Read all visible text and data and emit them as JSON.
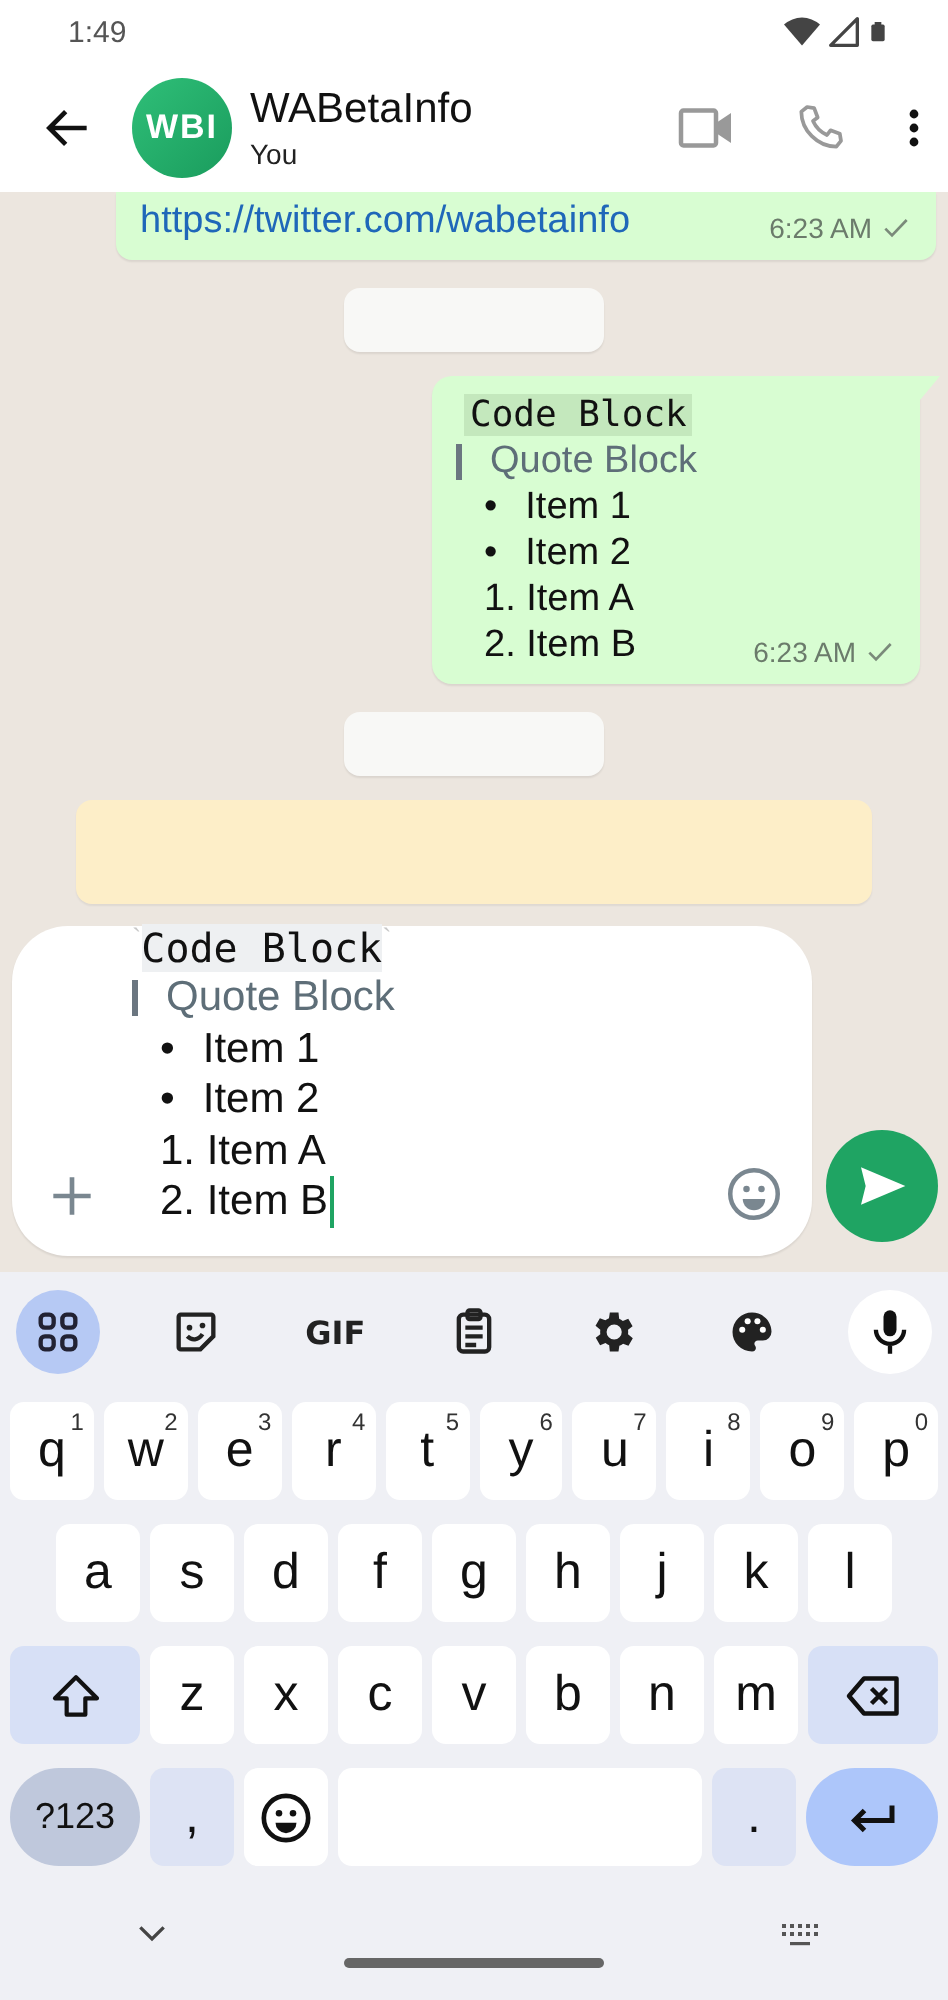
{
  "status_bar": {
    "time": "1:49"
  },
  "header": {
    "avatar_text": "WBI",
    "title": "WABetaInfo",
    "subtitle": "You"
  },
  "messages": [
    {
      "kind": "link",
      "text": "https://twitter.com/wabetainfo",
      "time": "6:23 AM",
      "read": false
    },
    {
      "kind": "blank_chip"
    },
    {
      "kind": "formatted",
      "time": "6:23 AM",
      "read": false,
      "lines": [
        {
          "kind": "code",
          "text": "Code Block"
        },
        {
          "kind": "quote",
          "text": "Quote Block"
        },
        {
          "kind": "bullet",
          "marker": "•",
          "text": "Item 1"
        },
        {
          "kind": "bullet",
          "marker": "•",
          "text": "Item 2"
        },
        {
          "kind": "numbered",
          "text": "1. Item A"
        },
        {
          "kind": "numbered",
          "text": "2. Item B"
        }
      ]
    },
    {
      "kind": "blank_chip"
    },
    {
      "kind": "banner"
    }
  ],
  "composer": {
    "fence": "`",
    "cursor_visible": true,
    "lines": [
      {
        "kind": "code",
        "text": "Code Block"
      },
      {
        "kind": "quote",
        "text": "Quote Block"
      },
      {
        "kind": "bullet",
        "marker": "•",
        "text": "Item 1"
      },
      {
        "kind": "bullet",
        "marker": "•",
        "text": "Item 2"
      },
      {
        "kind": "numbered",
        "text": "1. Item A"
      },
      {
        "kind": "numbered",
        "text": "2. Item B"
      }
    ]
  },
  "keyboard": {
    "toolbar": [
      {
        "kind": "apps",
        "selected": true
      },
      {
        "kind": "sticker",
        "selected": false
      },
      {
        "kind": "gif",
        "label": "GIF",
        "selected": false
      },
      {
        "kind": "clipboard",
        "selected": false
      },
      {
        "kind": "settings",
        "selected": false
      },
      {
        "kind": "palette",
        "selected": false
      },
      {
        "kind": "mic",
        "selected": false
      }
    ],
    "rows": [
      {
        "keys": [
          {
            "kind": "letter",
            "label": "q",
            "hint": "1"
          },
          {
            "kind": "letter",
            "label": "w",
            "hint": "2"
          },
          {
            "kind": "letter",
            "label": "e",
            "hint": "3"
          },
          {
            "kind": "letter",
            "label": "r",
            "hint": "4"
          },
          {
            "kind": "letter",
            "label": "t",
            "hint": "5"
          },
          {
            "kind": "letter",
            "label": "y",
            "hint": "6"
          },
          {
            "kind": "letter",
            "label": "u",
            "hint": "7"
          },
          {
            "kind": "letter",
            "label": "i",
            "hint": "8"
          },
          {
            "kind": "letter",
            "label": "o",
            "hint": "9"
          },
          {
            "kind": "letter",
            "label": "p",
            "hint": "0"
          }
        ]
      },
      {
        "keys": [
          {
            "kind": "letter",
            "label": "a"
          },
          {
            "kind": "letter",
            "label": "s"
          },
          {
            "kind": "letter",
            "label": "d"
          },
          {
            "kind": "letter",
            "label": "f"
          },
          {
            "kind": "letter",
            "label": "g"
          },
          {
            "kind": "letter",
            "label": "h"
          },
          {
            "kind": "letter",
            "label": "j"
          },
          {
            "kind": "letter",
            "label": "k"
          },
          {
            "kind": "letter",
            "label": "l"
          }
        ]
      },
      {
        "keys": [
          {
            "kind": "shift"
          },
          {
            "kind": "letter",
            "label": "z"
          },
          {
            "kind": "letter",
            "label": "x"
          },
          {
            "kind": "letter",
            "label": "c"
          },
          {
            "kind": "letter",
            "label": "v"
          },
          {
            "kind": "letter",
            "label": "b"
          },
          {
            "kind": "letter",
            "label": "n"
          },
          {
            "kind": "letter",
            "label": "m"
          },
          {
            "kind": "backspace"
          }
        ]
      },
      {
        "keys": [
          {
            "kind": "symbols",
            "label": "?123"
          },
          {
            "kind": "punct",
            "label": ","
          },
          {
            "kind": "emoji"
          },
          {
            "kind": "space"
          },
          {
            "kind": "punct",
            "label": "."
          },
          {
            "kind": "enter"
          }
        ]
      }
    ]
  }
}
